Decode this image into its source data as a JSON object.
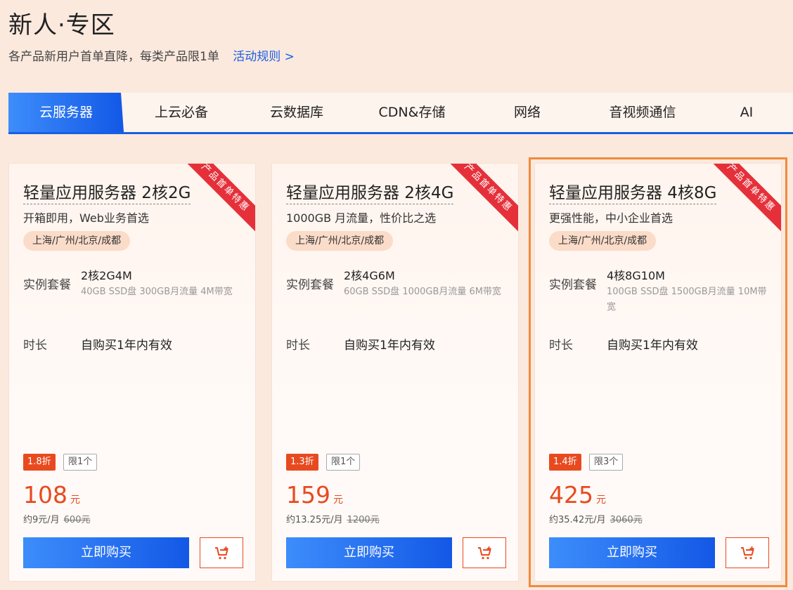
{
  "page": {
    "title": "新人·专区",
    "subtitle": "各产品新用户首单直降，每类产品限1单",
    "rules_link": "活动规则 >"
  },
  "tabs": [
    {
      "label": "云服务器",
      "active": true
    },
    {
      "label": "上云必备"
    },
    {
      "label": "云数据库"
    },
    {
      "label": "CDN&存储"
    },
    {
      "label": "网络"
    },
    {
      "label": "音视频通信"
    },
    {
      "label": "AI"
    }
  ],
  "colors": {
    "accent": "#1a5fe0",
    "price": "#e84a20",
    "ribbon": "#e5303a",
    "highlight": "#f08a3c"
  },
  "cards": [
    {
      "ribbon": "产品首单特惠",
      "name": "轻量应用服务器 2核2G",
      "desc": "开箱即用，Web业务首选",
      "region": "上海/广州/北京/成都",
      "spec_label": "实例套餐",
      "spec_main": "2核2G4M",
      "spec_sub": "40GB SSD盘 300GB月流量 4M带宽",
      "duration_label": "时长",
      "duration_value": "自购买1年内有效",
      "discount": "1.8折",
      "limit": "限1个",
      "price": "108",
      "price_unit": "元",
      "monthly": "约9元/月",
      "original_price": "600元",
      "buy_label": "立即购买"
    },
    {
      "ribbon": "产品首单特惠",
      "name": "轻量应用服务器 2核4G",
      "desc": "1000GB 月流量，性价比之选",
      "region": "上海/广州/北京/成都",
      "spec_label": "实例套餐",
      "spec_main": "2核4G6M",
      "spec_sub": "60GB SSD盘 1000GB月流量 6M带宽",
      "duration_label": "时长",
      "duration_value": "自购买1年内有效",
      "discount": "1.3折",
      "limit": "限1个",
      "price": "159",
      "price_unit": "元",
      "monthly": "约13.25元/月",
      "original_price": "1200元",
      "buy_label": "立即购买"
    },
    {
      "ribbon": "产品首单特惠",
      "name": "轻量应用服务器 4核8G",
      "desc": "更强性能，中小企业首选",
      "region": "上海/广州/北京/成都",
      "spec_label": "实例套餐",
      "spec_main": "4核8G10M",
      "spec_sub": "100GB SSD盘 1500GB月流量 10M带宽",
      "duration_label": "时长",
      "duration_value": "自购买1年内有效",
      "discount": "1.4折",
      "limit": "限3个",
      "price": "425",
      "price_unit": "元",
      "monthly": "约35.42元/月",
      "original_price": "3060元",
      "buy_label": "立即购买",
      "highlighted": true
    }
  ]
}
